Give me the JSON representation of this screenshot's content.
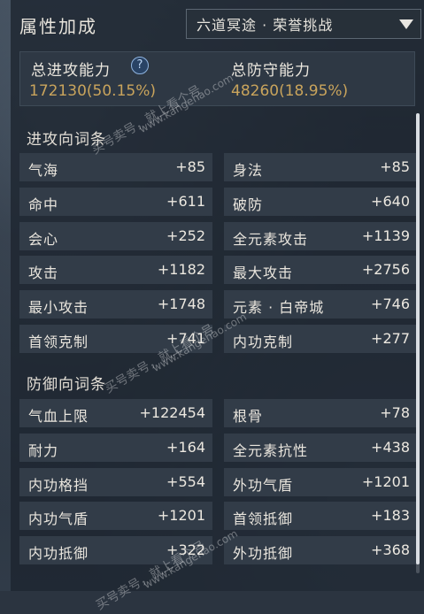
{
  "title": "属性加成",
  "mode_select": {
    "value": "六道冥途 · 荣誉挑战"
  },
  "summary": {
    "attack_label": "总进攻能力",
    "attack_value": "172130(50.15%)",
    "defense_label": "总防守能力",
    "defense_value": "48260(18.95%)"
  },
  "attack_section": {
    "title": "进攻向词条",
    "items": [
      {
        "name": "气海",
        "value": "+85"
      },
      {
        "name": "身法",
        "value": "+85"
      },
      {
        "name": "命中",
        "value": "+611"
      },
      {
        "name": "破防",
        "value": "+640"
      },
      {
        "name": "会心",
        "value": "+252"
      },
      {
        "name": "全元素攻击",
        "value": "+1139"
      },
      {
        "name": "攻击",
        "value": "+1182"
      },
      {
        "name": "最大攻击",
        "value": "+2756"
      },
      {
        "name": "最小攻击",
        "value": "+1748"
      },
      {
        "name": "元素 · 白帝城",
        "value": "+746"
      },
      {
        "name": "首领克制",
        "value": "+741"
      },
      {
        "name": "内功克制",
        "value": "+277"
      }
    ]
  },
  "defense_section": {
    "title": "防御向词条",
    "items": [
      {
        "name": "气血上限",
        "value": "+122454"
      },
      {
        "name": "根骨",
        "value": "+78"
      },
      {
        "name": "耐力",
        "value": "+164"
      },
      {
        "name": "全元素抗性",
        "value": "+438"
      },
      {
        "name": "内功格挡",
        "value": "+554"
      },
      {
        "name": "外功气盾",
        "value": "+1201"
      },
      {
        "name": "内功气盾",
        "value": "+1201"
      },
      {
        "name": "首领抵御",
        "value": "+183"
      },
      {
        "name": "内功抵御",
        "value": "+322"
      },
      {
        "name": "外功抵御",
        "value": "+368"
      }
    ]
  },
  "watermark": [
    "买号卖号，就上看个号",
    "www.kangehao.com",
    "看个号"
  ],
  "colors": {
    "accent_gold": "#c9a45c",
    "help_icon": "#8fb4e0"
  }
}
